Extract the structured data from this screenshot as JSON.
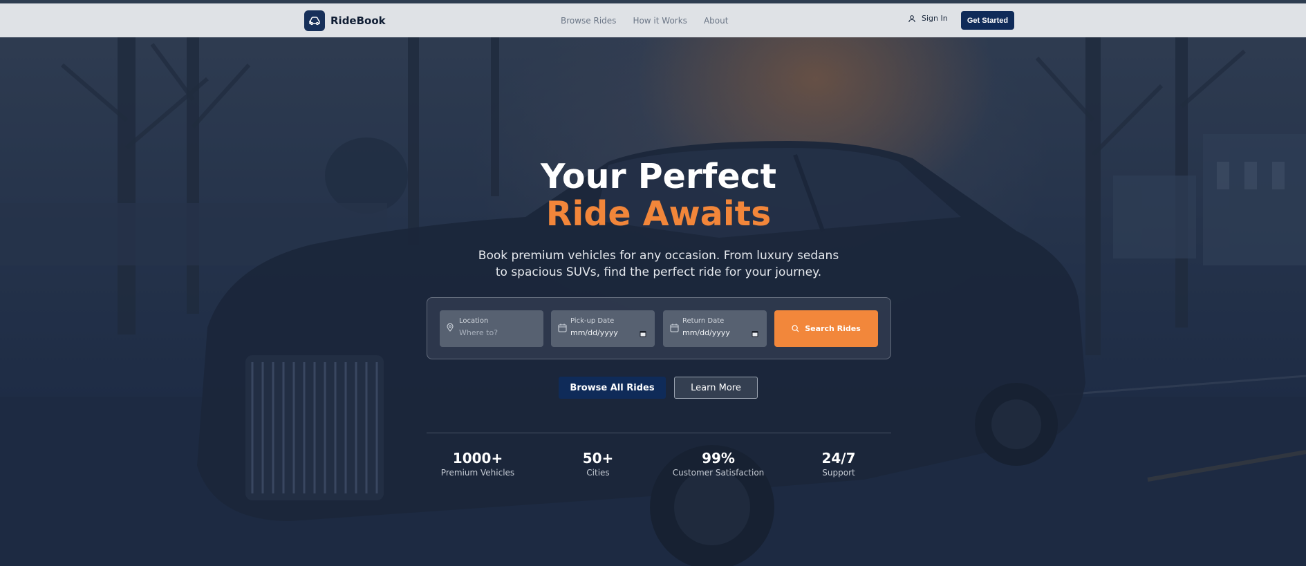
{
  "app": {
    "brand_name": "RideBook",
    "brand_icon": "car-icon"
  },
  "nav": {
    "items": [
      {
        "label": "Browse Rides"
      },
      {
        "label": "How it Works"
      },
      {
        "label": "About"
      }
    ],
    "sign_in": "Sign In",
    "sign_in_icon": "user-icon",
    "get_started": "Get Started"
  },
  "hero": {
    "title_line1": "Your Perfect",
    "title_line2": "Ride Awaits",
    "subtitle": "Book premium vehicles for any occasion. From luxury sedans to spacious SUVs, find the perfect ride for your journey.",
    "accent_color": "#f2863a",
    "primary_color": "#0f2b59"
  },
  "search": {
    "location_label": "Location",
    "location_placeholder": "Where to?",
    "pickup_label": "Pick-up Date",
    "pickup_placeholder": "mm/dd/yyyy",
    "return_label": "Return Date",
    "return_placeholder": "mm/dd/yyyy",
    "search_button": "Search Rides"
  },
  "actions": {
    "browse_all": "Browse All Rides",
    "learn_more": "Learn More"
  },
  "stats": [
    {
      "value": "1000+",
      "label": "Premium Vehicles"
    },
    {
      "value": "50+",
      "label": "Cities"
    },
    {
      "value": "99%",
      "label": "Customer Satisfaction"
    },
    {
      "value": "24/7",
      "label": "Support"
    }
  ]
}
